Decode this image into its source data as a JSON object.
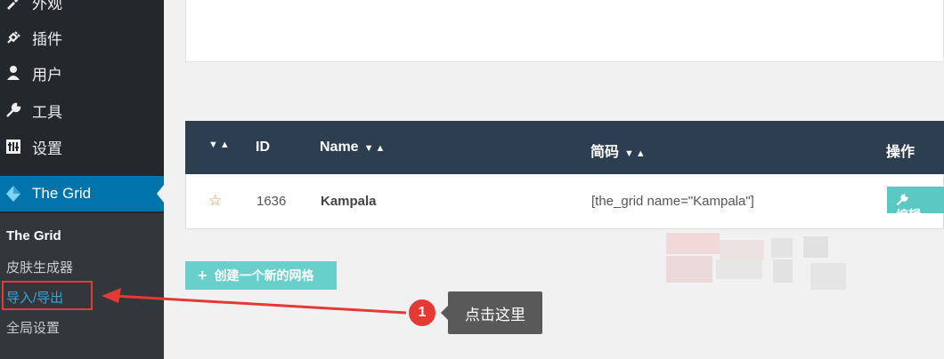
{
  "sidebar": {
    "items": [
      {
        "label": "外观",
        "icon": "paintbrush-icon"
      },
      {
        "label": "插件",
        "icon": "plugin-icon"
      },
      {
        "label": "用户",
        "icon": "user-icon"
      },
      {
        "label": "工具",
        "icon": "wrench-icon"
      },
      {
        "label": "设置",
        "icon": "settings-icon"
      },
      {
        "label": "The Grid",
        "icon": "the-grid-logo-icon",
        "active": true
      }
    ],
    "submenu": [
      "The Grid",
      "皮肤生成器",
      "导入/导出",
      "全局设置"
    ]
  },
  "table": {
    "headers": {
      "sort": "▼▲",
      "id": "ID",
      "name": "Name",
      "shortcode": "简码",
      "actions": "操作"
    },
    "rows": [
      {
        "id": "1636",
        "name": "Kampala",
        "shortcode": "[the_grid name=\"Kampala\"]",
        "edit": "编辑"
      }
    ]
  },
  "create_button": "创建一个新的网格",
  "annotation": {
    "number": "1",
    "text": "点击这里"
  },
  "colors": {
    "sidebar": "#23282d",
    "active": "#0073aa",
    "table_header": "#2c3e50",
    "teal": "#5bc8c4",
    "marker": "#e53935"
  }
}
